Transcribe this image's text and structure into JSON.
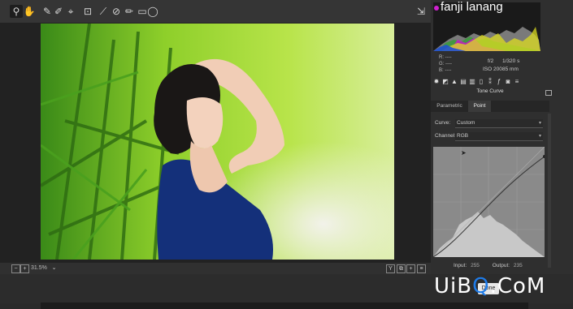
{
  "toolbar": {
    "tools": [
      "zoom-icon",
      "hand-icon",
      "white-balance-icon",
      "color-sampler-icon",
      "target-adjust-icon",
      "crop-icon",
      "straighten-icon",
      "spot-removal-icon",
      "adjustment-brush-icon",
      "graduated-filter-icon",
      "radial-filter-icon"
    ],
    "fullscreen_icon": "fullscreen-icon"
  },
  "histogram": {
    "label": "fanji lanang",
    "r": "R:  ----",
    "g": "G:  ----",
    "b": "B:  ----",
    "aperture": "f/2",
    "shutter": "1/320 s",
    "iso": "ISO 200",
    "focal": "85 mm"
  },
  "panel": {
    "title": "Tone Curve",
    "tabs": [
      "Parametric",
      "Point"
    ],
    "curve_label": "Curve:",
    "curve_value": "Custom",
    "channel_label": "Channel:",
    "channel_value": "RGB",
    "input_label": "Input:",
    "input_value": "255",
    "output_label": "Output:",
    "output_value": "235"
  },
  "status": {
    "zoom": "31.5%"
  },
  "watermark": {
    "pre": "UiB",
    "ring": "Q",
    "post": ".CoM"
  },
  "done_button": "Done",
  "colors": {
    "accent": "#1e7be8",
    "panel_bg": "#2f2f2f"
  }
}
